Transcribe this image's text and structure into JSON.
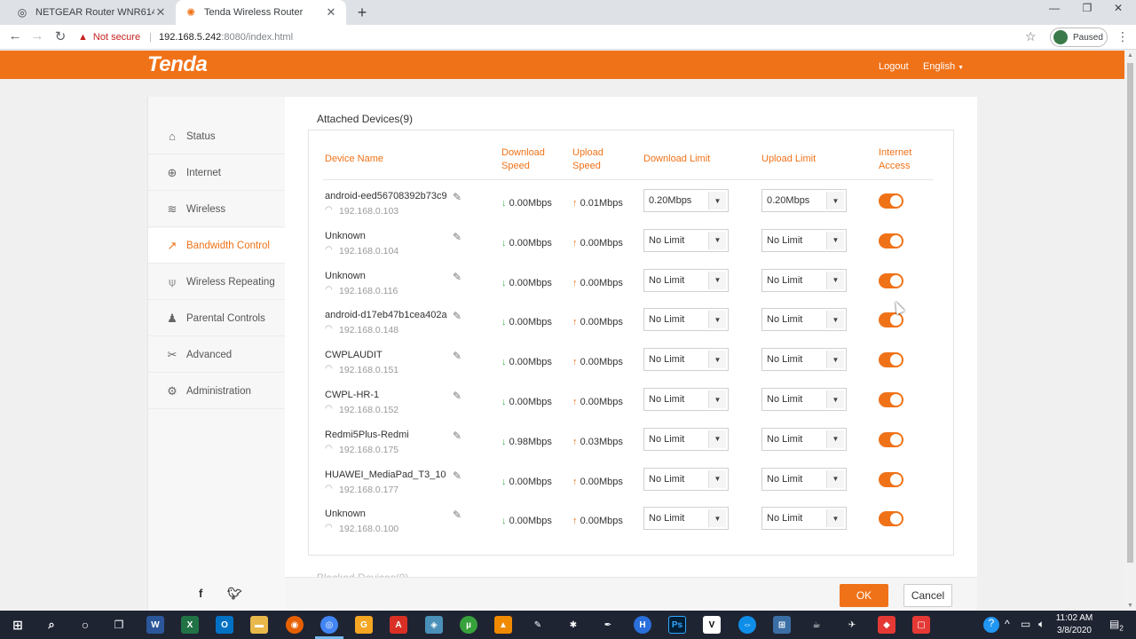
{
  "browser": {
    "tabs": [
      {
        "title": "NETGEAR Router WNR614",
        "active": false
      },
      {
        "title": "Tenda Wireless Router",
        "active": true
      }
    ],
    "security_label": "Not secure",
    "url_host": "192.168.5.242",
    "url_rest": ":8080/index.html",
    "profile_label": "Paused"
  },
  "header": {
    "logo": "Tenda",
    "logout": "Logout",
    "language": "English"
  },
  "sidebar": {
    "items": [
      {
        "label": "Status",
        "icon": "gauge-icon"
      },
      {
        "label": "Internet",
        "icon": "globe-icon"
      },
      {
        "label": "Wireless",
        "icon": "wifi-icon"
      },
      {
        "label": "Bandwidth Control",
        "icon": "chart-line-icon",
        "active": true
      },
      {
        "label": "Wireless Repeating",
        "icon": "antenna-icon"
      },
      {
        "label": "Parental Controls",
        "icon": "person-icon"
      },
      {
        "label": "Advanced",
        "icon": "tools-icon"
      },
      {
        "label": "Administration",
        "icon": "gears-icon"
      }
    ],
    "social": [
      "f",
      "twitter"
    ]
  },
  "main": {
    "section_title": "Attached Devices(9)",
    "blocked_title": "Blocked Devices(0)",
    "columns": {
      "device_name": "Device Name",
      "download_speed": "Download Speed",
      "upload_speed": "Upload Speed",
      "download_limit": "Download Limit",
      "upload_limit": "Upload Limit",
      "internet_access": "Internet Access"
    },
    "devices": [
      {
        "name": "android-eed56708392b73c9",
        "ip": "192.168.0.103",
        "down": "0.00Mbps",
        "up": "0.01Mbps",
        "down_limit": "0.20Mbps",
        "up_limit": "0.20Mbps",
        "access": true
      },
      {
        "name": "Unknown",
        "ip": "192.168.0.104",
        "down": "0.00Mbps",
        "up": "0.00Mbps",
        "down_limit": "No Limit",
        "up_limit": "No Limit",
        "access": true
      },
      {
        "name": "Unknown",
        "ip": "192.168.0.116",
        "down": "0.00Mbps",
        "up": "0.00Mbps",
        "down_limit": "No Limit",
        "up_limit": "No Limit",
        "access": true
      },
      {
        "name": "android-d17eb47b1cea402a",
        "ip": "192.168.0.148",
        "down": "0.00Mbps",
        "up": "0.00Mbps",
        "down_limit": "No Limit",
        "up_limit": "No Limit",
        "access": true
      },
      {
        "name": "CWPLAUDIT",
        "ip": "192.168.0.151",
        "down": "0.00Mbps",
        "up": "0.00Mbps",
        "down_limit": "No Limit",
        "up_limit": "No Limit",
        "access": true
      },
      {
        "name": "CWPL-HR-1",
        "ip": "192.168.0.152",
        "down": "0.00Mbps",
        "up": "0.00Mbps",
        "down_limit": "No Limit",
        "up_limit": "No Limit",
        "access": true
      },
      {
        "name": "Redmi5Plus-Redmi",
        "ip": "192.168.0.175",
        "down": "0.98Mbps",
        "up": "0.03Mbps",
        "down_limit": "No Limit",
        "up_limit": "No Limit",
        "access": true
      },
      {
        "name": "HUAWEI_MediaPad_T3_10",
        "ip": "192.168.0.177",
        "down": "0.00Mbps",
        "up": "0.00Mbps",
        "down_limit": "No Limit",
        "up_limit": "No Limit",
        "access": true
      },
      {
        "name": "Unknown",
        "ip": "192.168.0.100",
        "down": "0.00Mbps",
        "up": "0.00Mbps",
        "down_limit": "No Limit",
        "up_limit": "No Limit",
        "access": true
      }
    ],
    "ok_label": "OK",
    "cancel_label": "Cancel"
  },
  "taskbar": {
    "time": "11:02 AM",
    "date": "3/8/2020",
    "notification_count": "2"
  },
  "colors": {
    "accent": "#f07218",
    "download_arrow": "#4caf50"
  }
}
